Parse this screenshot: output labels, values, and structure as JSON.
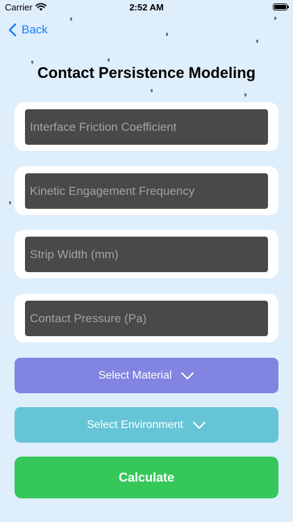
{
  "status_bar": {
    "carrier": "Carrier",
    "time": "2:52 AM"
  },
  "nav": {
    "back_label": "Back"
  },
  "title": "Contact Persistence Modeling",
  "fields": [
    {
      "placeholder": "Interface Friction Coefficient",
      "value": ""
    },
    {
      "placeholder": "Kinetic Engagement Frequency",
      "value": ""
    },
    {
      "placeholder": "Strip Width (mm)",
      "value": ""
    },
    {
      "placeholder": "Contact Pressure (Pa)",
      "value": ""
    }
  ],
  "selects": {
    "material_label": "Select Material",
    "environment_label": "Select Environment"
  },
  "calculate_label": "Calculate",
  "colors": {
    "background": "#dfeefb",
    "accent": "#1a7ff7",
    "material_button": "#8184e0",
    "environment_button": "#66c4d7",
    "calculate_button": "#35c759",
    "field_fill": "#494949"
  },
  "icons": {
    "back": "chevron-left-icon",
    "dropdown": "chevron-down-icon",
    "wifi": "wifi-icon",
    "battery": "battery-icon"
  }
}
